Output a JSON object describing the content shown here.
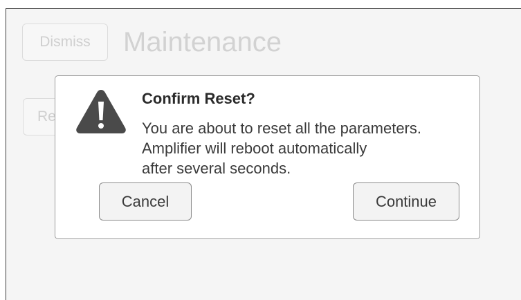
{
  "header": {
    "dismiss_label": "Dismiss",
    "title": "Maintenance"
  },
  "background": {
    "reset_button_label": "Reset"
  },
  "dialog": {
    "icon": "warning-icon",
    "title": "Confirm Reset?",
    "message_lines": [
      "You are about to reset all the parameters.",
      "Amplifier will reboot automatically",
      "after several seconds."
    ],
    "cancel_label": "Cancel",
    "continue_label": "Continue"
  },
  "colors": {
    "icon": "#4a4a4a",
    "dialog_border": "#9b9b9b",
    "background": "#f5f5f5"
  }
}
